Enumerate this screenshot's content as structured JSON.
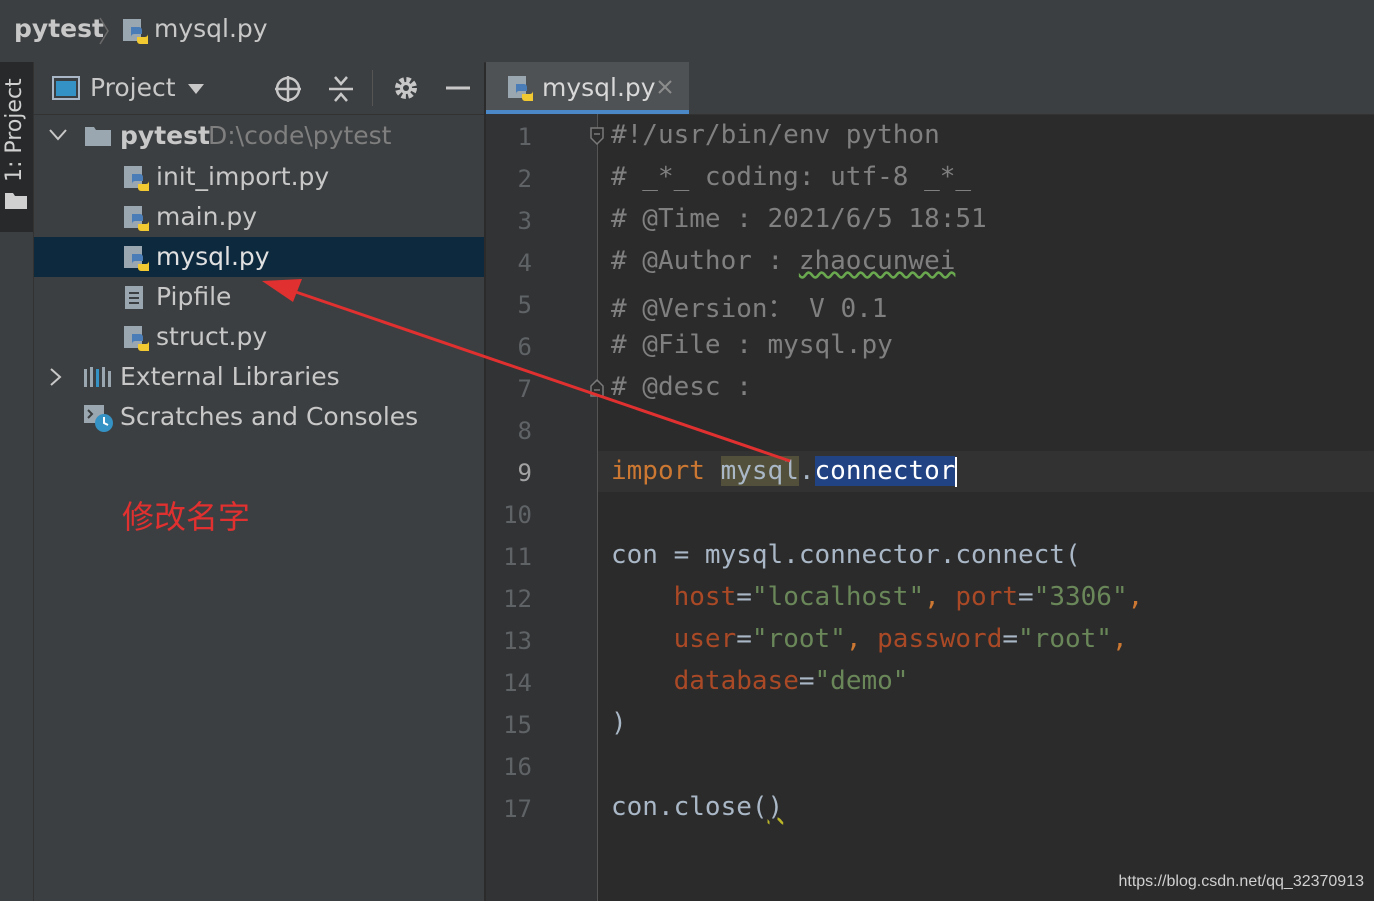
{
  "breadcrumb": {
    "project": "pytest",
    "file": "mysql.py"
  },
  "stripe": {
    "label": "1: Project"
  },
  "project_panel": {
    "view_label": "Project",
    "root": {
      "name": "pytest",
      "path": "D:\\code\\pytest"
    },
    "files": [
      {
        "name": "init_import.py",
        "icon": "python-file-icon"
      },
      {
        "name": "main.py",
        "icon": "python-file-icon"
      },
      {
        "name": "mysql.py",
        "icon": "python-file-icon",
        "selected": true
      },
      {
        "name": "Pipfile",
        "icon": "text-file-icon"
      },
      {
        "name": "struct.py",
        "icon": "python-file-icon"
      }
    ],
    "external_libraries": "External Libraries",
    "scratches": "Scratches and Consoles"
  },
  "annotation": {
    "text": "修改名字",
    "color": "#e03030"
  },
  "editor": {
    "tab_label": "mysql.py",
    "current_line": 9,
    "line_numbers": [
      "1",
      "2",
      "3",
      "4",
      "5",
      "6",
      "7",
      "8",
      "9",
      "10",
      "11",
      "12",
      "13",
      "14",
      "15",
      "16",
      "17"
    ],
    "code": {
      "l1": "#!/usr/bin/env python",
      "l2": "# _*_ coding: utf-8 _*_",
      "l3": "# @Time : 2021/6/5 18:51",
      "l4_prefix": "# @Author : ",
      "l4_name": "zhaocunwei",
      "l5": "# @Version： V 0.1",
      "l6": "# @File : mysql.py",
      "l7": "# @desc :",
      "l9_kw": "import",
      "l9_mod": "mysql",
      "l9_dot": ".",
      "l9_sub": "connector",
      "l11": "con = mysql.connector.connect(",
      "l12_p1": "host",
      "l12_v1": "\"localhost\"",
      "l12_p2": "port",
      "l12_v2": "\"3306\"",
      "l13_p1": "user",
      "l13_v1": "\"root\"",
      "l13_p2": "password",
      "l13_v2": "\"root\"",
      "l14_p1": "database",
      "l14_v1": "\"demo\"",
      "l15": ")",
      "l17_pre": "con.close(",
      "l17_post": ")"
    }
  },
  "watermark": "https://blog.csdn.net/qq_32370913",
  "colors": {
    "background": "#2b2b2b",
    "panel": "#3c3f41",
    "selection": "#0d293e",
    "keyword": "#cc7832",
    "string": "#6a8759",
    "comment": "#808080",
    "param": "#aa4926",
    "arrow": "#e03030"
  }
}
